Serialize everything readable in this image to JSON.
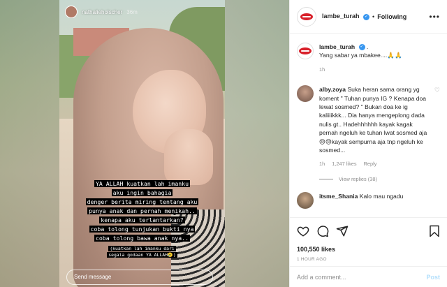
{
  "story": {
    "username": "nathalieholscher",
    "time": "36m",
    "caption_lines": [
      "YA ALLAH kuatkan lah imanku",
      "aku ingin bahagia",
      "denger berita miring tentang aku",
      "punya anak dan pernah menikah..",
      "kenapa aku terlantarkan?",
      "coba tolong tunjukan bukti nya",
      "coba tolong bawa anak nya.."
    ],
    "caption_small": [
      "(kuatkan lah imanku dari",
      "segala godaan YA ALLAH😢)"
    ],
    "send_placeholder": "Send message"
  },
  "post": {
    "header": {
      "username": "lambe_turah",
      "verified_mark": "✓",
      "dot": "•",
      "follow_label": "Following",
      "more_label": "•••"
    },
    "caption": {
      "username": "lambe_turah",
      "text": "Yang sabar ya mbakee....🙏🙏",
      "time": "1h"
    },
    "comments": [
      {
        "username": "alby.zoya",
        "text": "Suka heran sama orang yg koment \" Tuhan punya IG ? Kenapa doa lewat sosmed? \" Bukan doa ke ig kaliiiikkk... Dia hanya mengeplong dada nulis gt.. Hadehhhhhh kayak kagak pernah ngeluh ke tuhan lwat sosmed aja 😒😒kayak sempurna aja tnp ngeluh ke sosmed...",
        "time": "1h",
        "likes": "1,247 likes",
        "reply_label": "Reply",
        "view_replies": "View replies (38)"
      },
      {
        "username": "itsme_Shania",
        "text": "Kalo mau ngadu"
      }
    ],
    "likes": "100,550 likes",
    "ago": "1 HOUR AGO",
    "add_comment_placeholder": "Add a comment...",
    "post_label": "Post"
  },
  "icons": [
    "heart-icon",
    "comment-icon",
    "share-icon",
    "bookmark-icon",
    "verified-icon"
  ],
  "colors": {
    "verified": "#3897f0",
    "brand_red": "#d8212b",
    "muted": "#8e8e8e",
    "post_disabled": "#b2dffc"
  }
}
